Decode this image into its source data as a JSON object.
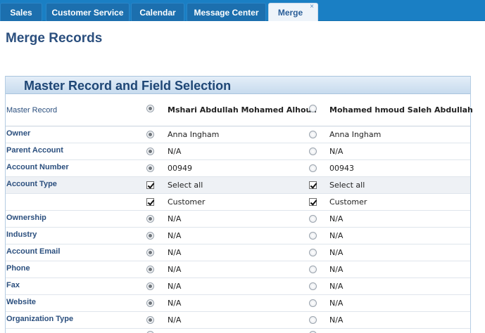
{
  "tabs": [
    {
      "label": "Sales"
    },
    {
      "label": "Customer Service"
    },
    {
      "label": "Calendar"
    },
    {
      "label": "Message Center"
    },
    {
      "label": "Merge",
      "active": true,
      "close_glyph": "×"
    }
  ],
  "page": {
    "title": "Merge Records"
  },
  "panel": {
    "title": "Master Record and Field Selection"
  },
  "master_row": {
    "label": "Master Record",
    "record1": {
      "name": "Mshari Abdullah Mohamed Alhouli",
      "selected": true
    },
    "record2": {
      "name": "Mohamed hmoud Saleh Abdullah",
      "selected": false
    }
  },
  "fields": [
    {
      "label": "Owner",
      "v1": "Anna Ingham",
      "v2": "Anna Ingham"
    },
    {
      "label": "Parent Account",
      "v1": "N/A",
      "v2": "N/A"
    },
    {
      "label": "Account Number",
      "v1": "00949",
      "v2": "00943"
    },
    {
      "label": "Account Type",
      "v1": "Select all",
      "v2": "Select all"
    },
    {
      "label": "",
      "v1": "Customer",
      "v2": "Customer"
    },
    {
      "label": "Ownership",
      "v1": "N/A",
      "v2": "N/A"
    },
    {
      "label": "Industry",
      "v1": "N/A",
      "v2": "N/A"
    },
    {
      "label": "Account Email",
      "v1": "N/A",
      "v2": "N/A"
    },
    {
      "label": "Phone",
      "v1": "N/A",
      "v2": "N/A"
    },
    {
      "label": "Fax",
      "v1": "N/A",
      "v2": "N/A"
    },
    {
      "label": "Website",
      "v1": "N/A",
      "v2": "N/A"
    },
    {
      "label": "Organization Type",
      "v1": "N/A",
      "v2": "N/A"
    }
  ],
  "colors": {
    "tab_bar": "#1a7fc4",
    "heading": "#2b4f7e",
    "panel_header": "#c7dbee"
  }
}
